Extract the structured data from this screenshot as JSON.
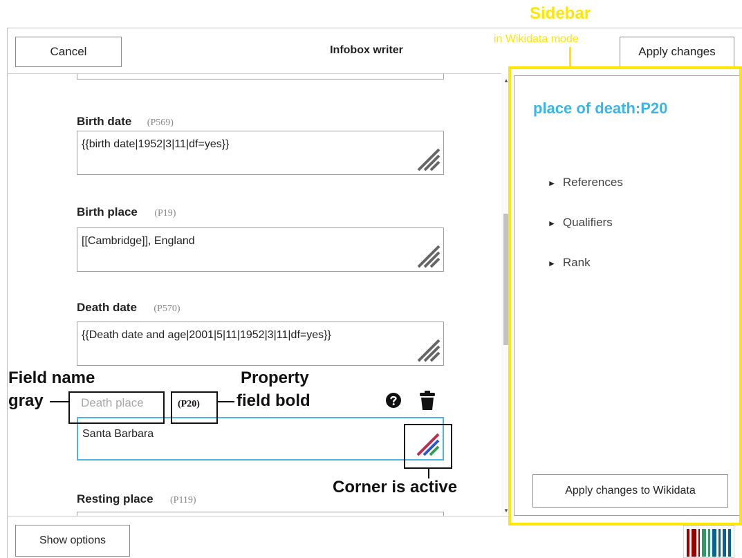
{
  "annotations": {
    "sidebar_title": "Sidebar",
    "sidebar_subtitle": "in Wikidata mode",
    "field_name_line1": "Field name",
    "field_name_line2": "gray",
    "property_line1": "Property",
    "property_line2": "field bold",
    "corner_active": "Corner is active"
  },
  "header": {
    "cancel_label": "Cancel",
    "title": "Infobox writer",
    "apply_label": "Apply changes"
  },
  "fields": [
    {
      "label": "Birth date",
      "property": "(P569)",
      "value": "{{birth date|1952|3|11|df=yes}}"
    },
    {
      "label": "Birth place",
      "property": "(P19)",
      "value": "[[Cambridge]], England"
    },
    {
      "label": "Death date",
      "property": "(P570)",
      "value": "{{Death date and age|2001|5|11|1952|3|11|df=yes}}"
    },
    {
      "label": "Death place",
      "property": "(P20)",
      "value": "Santa Barbara"
    },
    {
      "label": "Resting place",
      "property": "(P119)",
      "value": ""
    }
  ],
  "sidebar": {
    "title": "place of death:P20",
    "sections": [
      "References",
      "Qualifiers",
      "Rank"
    ],
    "apply_wikidata_label": "Apply changes to Wikidata"
  },
  "footer": {
    "options_label": "Show options"
  },
  "colors": {
    "accent": "#38b6e8",
    "highlight": "#ffe600",
    "active_border": "#49b6e6"
  },
  "icons": {
    "help": "help-icon",
    "delete": "trash-icon",
    "resize": "resize-corner-icon",
    "logo": "wikidata-logo-icon"
  }
}
